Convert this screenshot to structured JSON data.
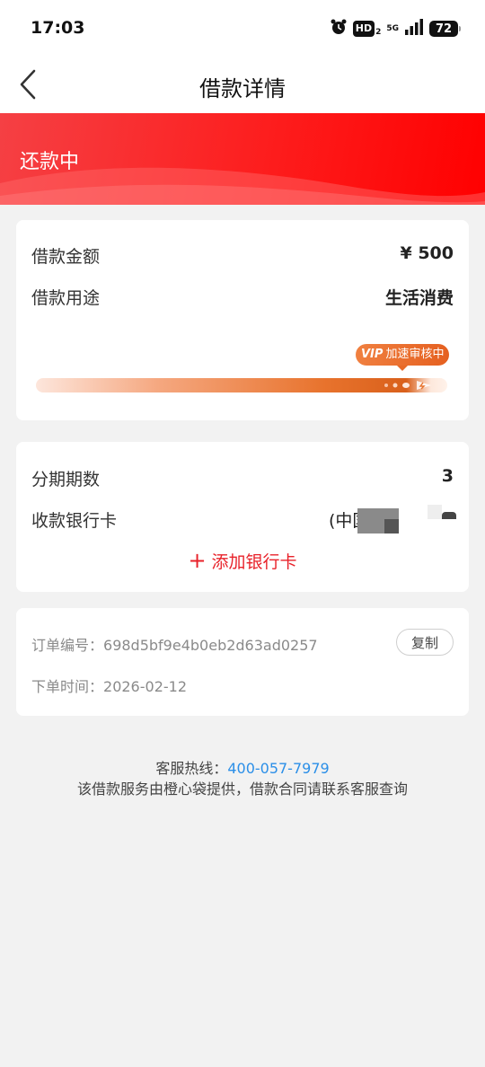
{
  "status_bar": {
    "time": "17:03",
    "hd_label": "HD",
    "hd_sub": "2",
    "network": "5G",
    "battery": "72"
  },
  "nav": {
    "title": "借款详情"
  },
  "hero": {
    "status": "还款中"
  },
  "loan": {
    "amount_label": "借款金额",
    "amount_value": "¥ 500",
    "purpose_label": "借款用途",
    "purpose_value": "生活消费",
    "vip_tag": "VIP",
    "vip_text": "加速审核中"
  },
  "installment": {
    "periods_label": "分期期数",
    "periods_value": "3",
    "bank_label": "收款银行卡",
    "bank_value": "(中国",
    "add_card_icon": "+",
    "add_card_label": "添加银行卡"
  },
  "order": {
    "number_label": "订单编号：",
    "number_value": "698d5bf9e4b0eb2d63ad0257",
    "copy_label": "复制",
    "time_label": "下单时间：",
    "time_value": "2026-02-12"
  },
  "footer": {
    "hotline_label": "客服热线：",
    "hotline_number": "400-057-7979",
    "note": "该借款服务由橙心袋提供，借款合同请联系客服查询"
  },
  "colors": {
    "brand_red": "#fd1d1d",
    "accent_orange": "#e8732d",
    "link_blue": "#2b8fe8"
  },
  "icons": [
    "alarm-icon",
    "signal-icon",
    "battery-icon",
    "back-chevron-icon",
    "plus-icon",
    "rocket-icon"
  ]
}
